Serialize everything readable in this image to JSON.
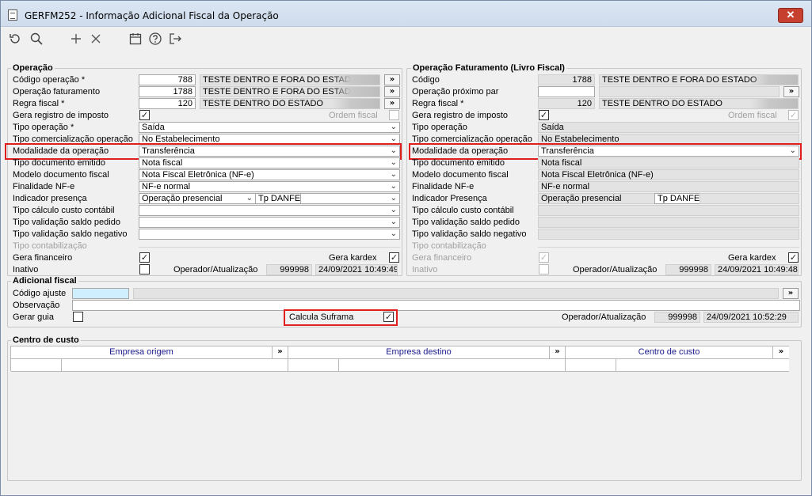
{
  "window": {
    "title": "GERFM252 - Informação Adicional Fiscal da Operação",
    "close_label": "✕"
  },
  "toolbar": {
    "icons": [
      "refresh-icon",
      "search-icon",
      "add-icon",
      "delete-icon",
      "calendar-icon",
      "help-icon",
      "exit-icon"
    ]
  },
  "operacao": {
    "title": "Operação",
    "labels": {
      "codigo": "Código operação *",
      "faturamento": "Operação faturamento",
      "regra": "Regra fiscal *",
      "gera_registro": "Gera registro de imposto",
      "ordem_fiscal": "Ordem fiscal",
      "tipo_operacao": "Tipo operação *",
      "tipo_comercializacao": "Tipo comercialização operação",
      "modalidade": "Modalidade da operação",
      "tipo_documento": "Tipo documento emitido",
      "modelo_documento": "Modelo documento fiscal",
      "finalidade": "Finalidade NF-e",
      "indicador": "Indicador presença",
      "tp_danfe": "Tp DANFE",
      "custo_contabil": "Tipo cálculo custo contábil",
      "validacao_pedido": "Tipo validação saldo pedido",
      "validacao_negativo": "Tipo validação saldo negativo",
      "contabilizacao": "Tipo contabilização",
      "gera_financeiro": "Gera financeiro",
      "gera_kardex": "Gera kardex",
      "inativo": "Inativo",
      "operador": "Operador/Atualização"
    },
    "values": {
      "codigo": "788",
      "codigo_desc": "TESTE DENTRO E FORA DO ESTADO I",
      "faturamento": "1788",
      "faturamento_desc": "TESTE DENTRO E FORA DO ESTADO I",
      "regra": "120",
      "regra_desc": "TESTE DENTRO DO ESTADO",
      "tipo_operacao": "Saída",
      "tipo_comercializacao": "No Estabelecimento",
      "modalidade": "Transferência",
      "tipo_documento": "Nota fiscal",
      "modelo_documento": "Nota Fiscal Eletrônica (NF-e)",
      "finalidade": "NF-e normal",
      "indicador": "Operação presencial",
      "operador": "999998",
      "atualizacao": "24/09/2021 10:49:49"
    }
  },
  "faturamento": {
    "title": "Operação Faturamento (Livro Fiscal)",
    "labels": {
      "codigo": "Código",
      "proximo_par": "Operação próximo par",
      "regra": "Regra fiscal *",
      "gera_registro": "Gera registro de imposto",
      "ordem_fiscal": "Ordem fiscal",
      "tipo_operacao": "Tipo operação",
      "tipo_comercializacao": "Tipo comercialização operação",
      "modalidade": "Modalidade da operação",
      "tipo_documento": "Tipo documento emitido",
      "modelo_documento": "Modelo documento fiscal",
      "finalidade": "Finalidade NF-e",
      "indicador": "Indicador Presença",
      "tp_danfe": "Tp DANFE",
      "custo_contabil": "Tipo cálculo custo contábil",
      "validacao_pedido": "Tipo validação saldo pedido",
      "validacao_negativo": "Tipo validação saldo negativo",
      "contabilizacao": "Tipo contabilização",
      "gera_financeiro": "Gera financeiro",
      "gera_kardex": "Gera kardex",
      "inativo": "Inativo",
      "operador": "Operador/Atualização"
    },
    "values": {
      "codigo": "1788",
      "codigo_desc": "TESTE DENTRO E FORA DO ESTADO",
      "regra": "120",
      "regra_desc": "TESTE DENTRO DO ESTADO",
      "tipo_operacao": "Saída",
      "tipo_comercializacao": "No Estabelecimento",
      "modalidade": "Transferência",
      "tipo_documento": "Nota fiscal",
      "modelo_documento": "Nota Fiscal Eletrônica (NF-e)",
      "finalidade": "NF-e normal",
      "indicador": "Operação presencial",
      "operador": "999998",
      "atualizacao": "24/09/2021 10:49:48"
    }
  },
  "adicional": {
    "title": "Adicional fiscal",
    "labels": {
      "codigo_ajuste": "Código ajuste",
      "observacao": "Observação",
      "gerar_guia": "Gerar guia",
      "calcula_suframa": "Calcula Suframa",
      "operador": "Operador/Atualização"
    },
    "values": {
      "operador": "999998",
      "atualizacao": "24/09/2021 10:52:29"
    }
  },
  "centro_custo": {
    "title": "Centro de custo",
    "columns": [
      "Empresa origem",
      "Empresa destino",
      "Centro de custo"
    ],
    "lookup_label": "»"
  },
  "common": {
    "lookup": "»",
    "dropdown": "⌄",
    "check": "✓"
  },
  "colors": {
    "highlight_red": "#e01e1e",
    "header_text": "#1a1a8c",
    "close_red": "#c7402f"
  }
}
